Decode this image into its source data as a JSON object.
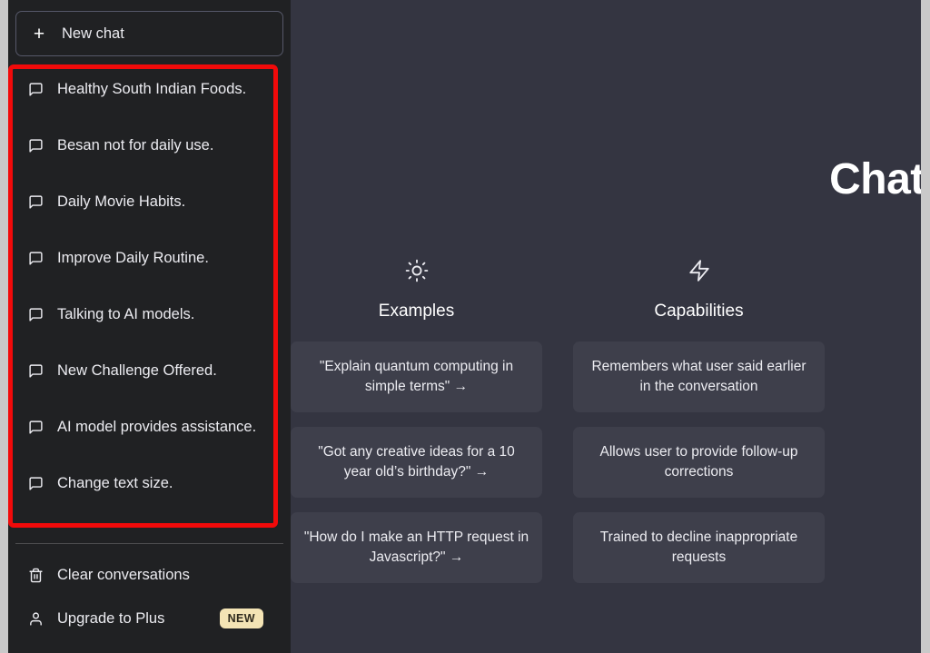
{
  "app": {
    "brand_title": "ChatGPT"
  },
  "sidebar": {
    "new_chat_label": "New chat",
    "new_chat_icon": "plus-icon",
    "conversations": [
      {
        "icon": "message-square-icon",
        "title": "Healthy South Indian Foods."
      },
      {
        "icon": "message-square-icon",
        "title": "Besan not for daily use."
      },
      {
        "icon": "message-square-icon",
        "title": "Daily Movie Habits."
      },
      {
        "icon": "message-square-icon",
        "title": "Improve Daily Routine."
      },
      {
        "icon": "message-square-icon",
        "title": "Talking to AI models."
      },
      {
        "icon": "message-square-icon",
        "title": "New Challenge Offered."
      },
      {
        "icon": "message-square-icon",
        "title": "AI model provides assistance."
      },
      {
        "icon": "message-square-icon",
        "title": "Change text size."
      }
    ],
    "footer": [
      {
        "icon": "trash-icon",
        "label": "Clear conversations",
        "badge": ""
      },
      {
        "icon": "user-icon",
        "label": "Upgrade to Plus",
        "badge": "NEW"
      }
    ]
  },
  "annotation": {
    "color": "#f10a0a",
    "target": "conversation-list"
  },
  "main": {
    "columns": [
      {
        "icon": "sun-icon",
        "title": "Examples",
        "cards": [
          "\"Explain quantum computing in simple terms\" →",
          "\"Got any creative ideas for a 10 year old’s birthday?\" →",
          "\"How do I make an HTTP request in Javascript?\" →"
        ]
      },
      {
        "icon": "lightning-icon",
        "title": "Capabilities",
        "cards": [
          "Remembers what user said earlier in the conversation",
          "Allows user to provide follow-up corrections",
          "Trained to decline inappropriate requests"
        ]
      }
    ]
  },
  "colors": {
    "sidebar_bg": "#202123",
    "main_bg": "#343541",
    "card_bg": "#3e3f4b",
    "accent_badge": "#f4e4b5",
    "annotation_red": "#f10a0a",
    "text_primary": "#ececf1"
  }
}
